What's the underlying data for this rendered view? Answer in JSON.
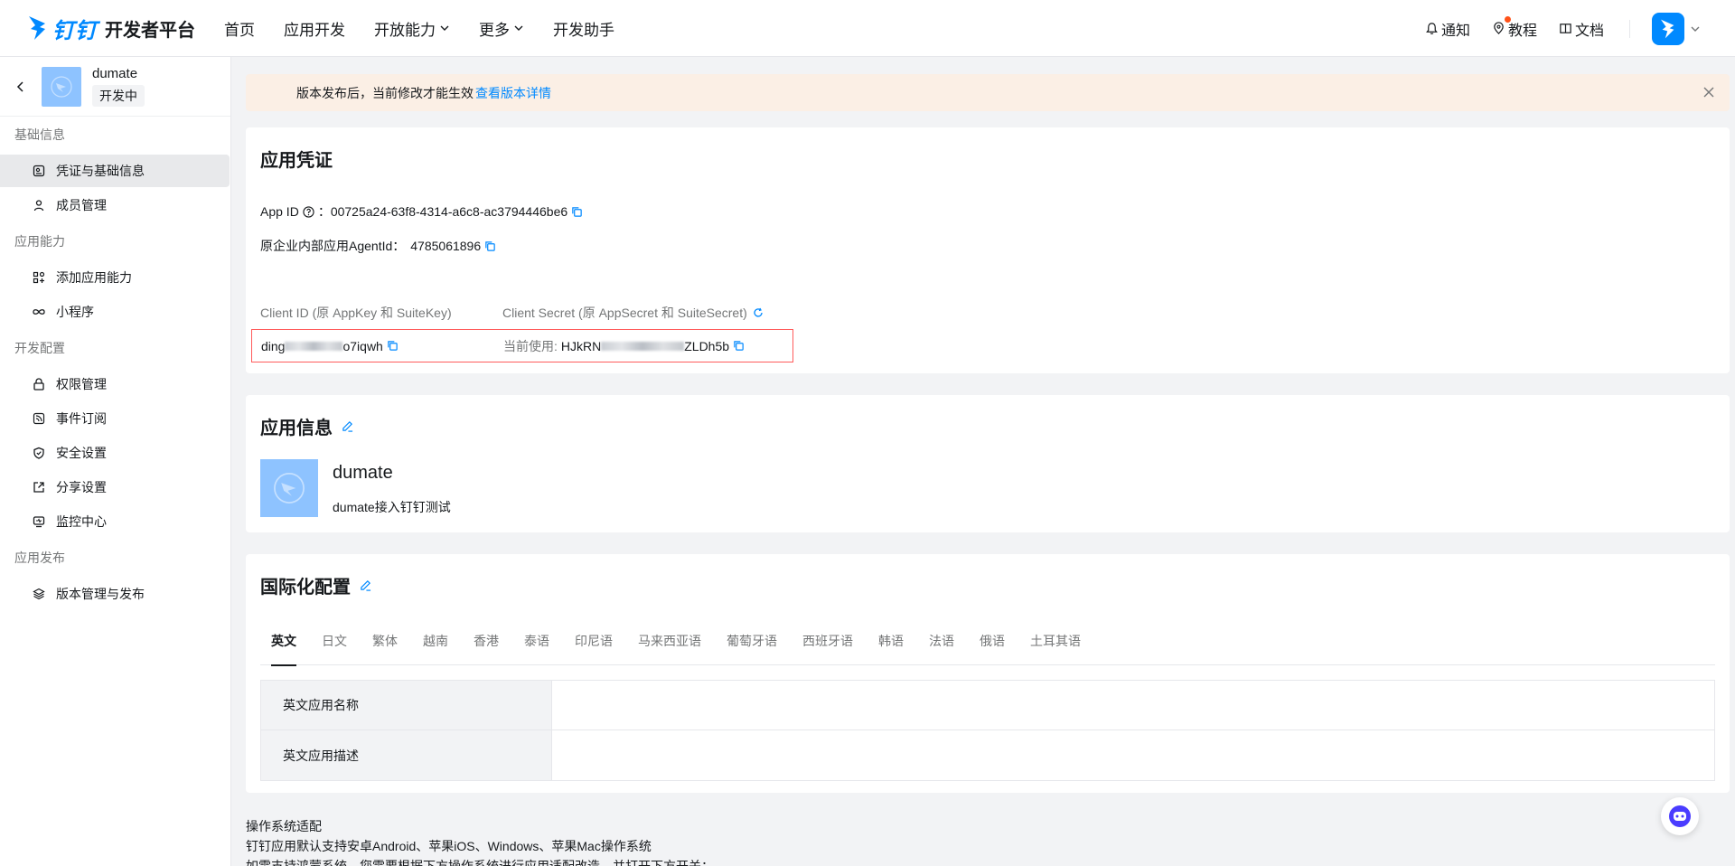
{
  "header": {
    "brand": "钉钉",
    "platform": "开发者平台",
    "nav": [
      {
        "label": "首页"
      },
      {
        "label": "应用开发"
      },
      {
        "label": "开放能力"
      },
      {
        "label": "更多"
      },
      {
        "label": "开发助手"
      }
    ],
    "right": {
      "notify": "通知",
      "tutorial": "教程",
      "docs": "文档"
    },
    "brand_color": "#0089ff"
  },
  "sidebar": {
    "app_name": "dumate",
    "app_status": "开发中",
    "groups": [
      {
        "label": "基础信息",
        "items": [
          {
            "label": "凭证与基础信息",
            "icon": "credential-icon"
          },
          {
            "label": "成员管理",
            "icon": "user-icon"
          }
        ]
      },
      {
        "label": "应用能力",
        "items": [
          {
            "label": "添加应用能力",
            "icon": "apps-icon"
          },
          {
            "label": "小程序",
            "icon": "infinity-icon"
          }
        ]
      },
      {
        "label": "开发配置",
        "items": [
          {
            "label": "权限管理",
            "icon": "lock-icon"
          },
          {
            "label": "事件订阅",
            "icon": "rss-icon"
          },
          {
            "label": "安全设置",
            "icon": "shield-icon"
          },
          {
            "label": "分享设置",
            "icon": "share-icon"
          },
          {
            "label": "监控中心",
            "icon": "monitor-icon"
          }
        ]
      },
      {
        "label": "应用发布",
        "items": [
          {
            "label": "版本管理与发布",
            "icon": "layers-icon"
          }
        ]
      }
    ]
  },
  "alert": {
    "text": "版本发布后，当前修改才能生效",
    "link": "查看版本详情"
  },
  "credentials": {
    "title": "应用凭证",
    "app_id_label": "App ID",
    "app_id_sep": "：",
    "app_id": "00725a24-63f8-4314-a6c8-ac3794446be6",
    "agent_id_label": "原企业内部应用AgentId：",
    "agent_id": "4785061896",
    "client_id_label": "Client ID (原 AppKey 和 SuiteKey)",
    "client_secret_label": "Client Secret (原 AppSecret 和 SuiteSecret)",
    "client_id_prefix": "ding",
    "client_id_suffix": "o7iqwh",
    "current_use_label": "当前使用:",
    "secret_prefix": "HJkRN",
    "secret_suffix": "ZLDh5b"
  },
  "app_info": {
    "title": "应用信息",
    "name": "dumate",
    "desc": "dumate接入钉钉测试"
  },
  "i18n": {
    "title": "国际化配置",
    "tabs": [
      "英文",
      "日文",
      "繁体",
      "越南",
      "香港",
      "泰语",
      "印尼语",
      "马来西亚语",
      "葡萄牙语",
      "西班牙语",
      "韩语",
      "法语",
      "俄语",
      "土耳其语"
    ],
    "rows": [
      "英文应用名称",
      "英文应用描述"
    ]
  },
  "os": {
    "title": "操作系统适配",
    "line1": "钉钉应用默认支持安卓Android、苹果iOS、Windows、苹果Mac操作系统",
    "line2": "如需支持鸿蒙系统，您需要根据下方操作系统进行应用适配改造，并打开下方开关："
  }
}
